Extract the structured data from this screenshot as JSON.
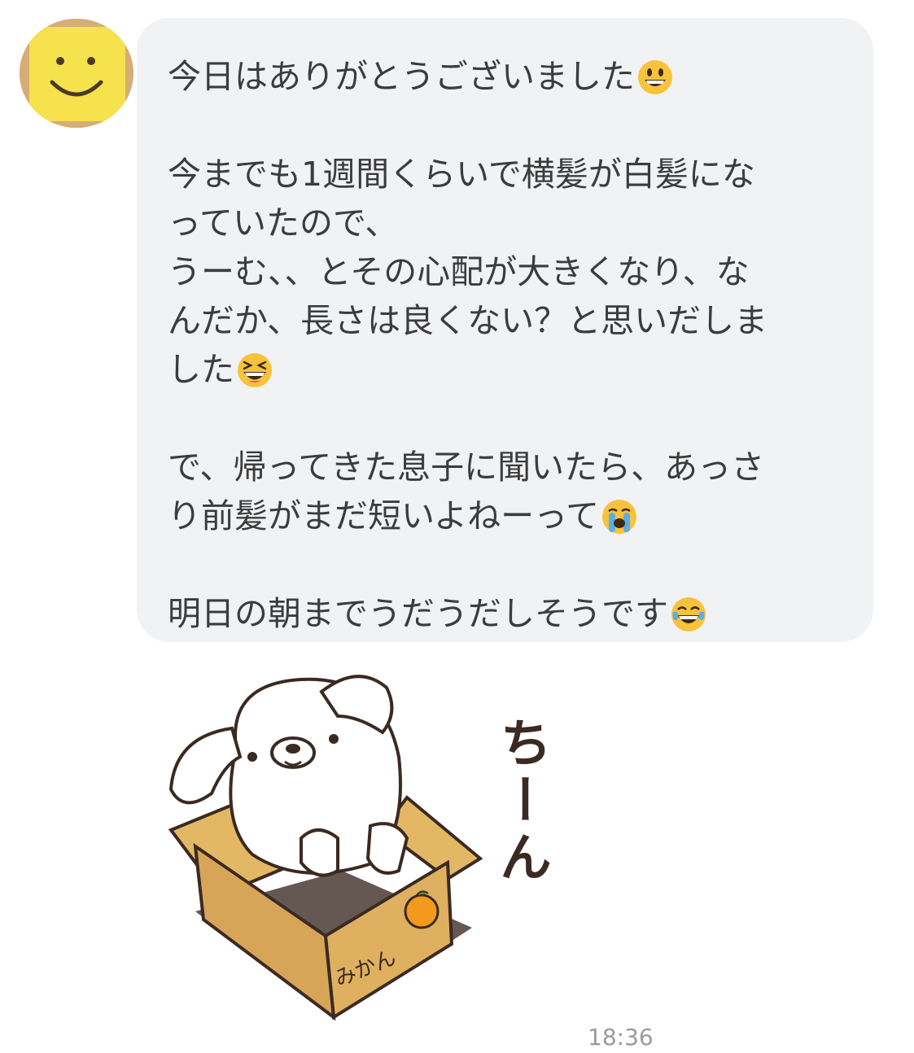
{
  "avatar": {
    "icon": "smiley-face-icon",
    "color": "#f5e14e"
  },
  "message": {
    "lines": [
      "今日はありがとうございました",
      "",
      "今までも1週間くらいで横髪が白髪にな",
      "っていたので、",
      "うーむ、、とその心配が大きくなり、な",
      "んだか、長さは良くない？と思いだしま",
      "した",
      "",
      "で、帰ってきた息子に聞いたら、あっさ",
      "り前髪がまだ短いよねーって",
      "",
      "明日の朝までうだうだしそうです"
    ],
    "emojis": {
      "line0": "grinning-face-icon",
      "line6": "grinning-squinting-face-icon",
      "line9": "loudly-crying-face-icon",
      "line11": "tears-of-joy-face-icon"
    }
  },
  "sticker": {
    "icon": "dog-in-box-sticker",
    "caption": "ちーん",
    "box_label": "みかん"
  },
  "timestamp": "18:36"
}
